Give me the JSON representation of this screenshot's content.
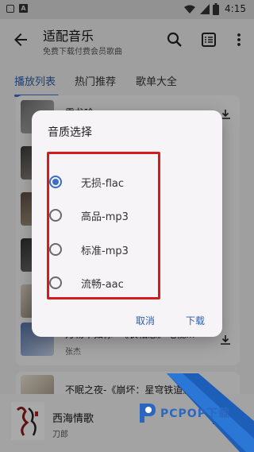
{
  "status_bar": {
    "time": "4:15"
  },
  "app_bar": {
    "title": "适配音乐",
    "subtitle": "免费下载付费会员歌曲",
    "icons": [
      "back-arrow-icon",
      "search-icon",
      "list-view-icon",
      "more-vert-icon"
    ]
  },
  "tabs": [
    {
      "label": "播放列表",
      "active": true
    },
    {
      "label": "热门推荐",
      "active": false
    },
    {
      "label": "歌单大全",
      "active": false
    }
  ],
  "songs": [
    {
      "title": "雪龙吟",
      "artist": ""
    },
    {
      "title": "万物不如你 -《长相思》电视...",
      "artist": "张杰"
    },
    {
      "title": "不眠之夜-《崩坏：星穹铁道》",
      "artist": ""
    }
  ],
  "dialog": {
    "title": "音质选择",
    "options": [
      {
        "label": "无损-flac",
        "selected": true
      },
      {
        "label": "高品-mp3",
        "selected": false
      },
      {
        "label": "标准-mp3",
        "selected": false
      },
      {
        "label": "流畅-aac",
        "selected": false
      }
    ],
    "cancel_label": "取消",
    "confirm_label": "下载"
  },
  "player": {
    "title": "西海情歌",
    "artist": "刀郎"
  },
  "watermark": {
    "text": "PCPOP下载"
  },
  "colors": {
    "accent": "#3b6fc4",
    "highlight_box": "#d21d1d"
  }
}
